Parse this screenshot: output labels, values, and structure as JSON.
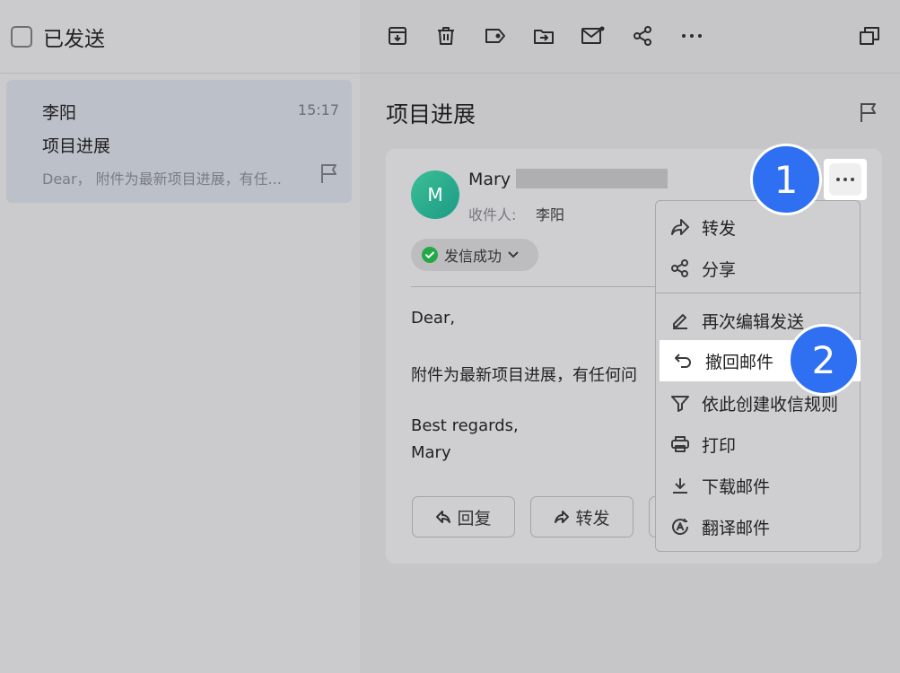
{
  "list": {
    "folder_title": "已发送",
    "item": {
      "sender": "李阳",
      "time": "15:17",
      "subject": "项目进展",
      "preview": "Dear， 附件为最新项目进展，有任..."
    }
  },
  "reader": {
    "subject": "项目进展",
    "sender_name": "Mary",
    "avatar_letter": "M",
    "recipient_label": "收件人:",
    "recipient_name": "李阳",
    "status": "发信成功",
    "body": {
      "greeting": "Dear,",
      "line1": "附件为最新项目进展，有任何问",
      "closing": "Best regards,",
      "signature": "Mary"
    },
    "actions": {
      "reply": "回复",
      "forward": "转发"
    }
  },
  "menu": {
    "items": [
      {
        "label": "转发",
        "icon": "forward-icon"
      },
      {
        "label": "分享",
        "icon": "share-icon"
      },
      {
        "label": "再次编辑发送",
        "icon": "edit-icon"
      },
      {
        "label": "撤回邮件",
        "icon": "undo-icon"
      },
      {
        "label": "依此创建收信规则",
        "icon": "filter-icon"
      },
      {
        "label": "打印",
        "icon": "print-icon"
      },
      {
        "label": "下载邮件",
        "icon": "download-icon"
      },
      {
        "label": "翻译邮件",
        "icon": "translate-icon"
      }
    ]
  },
  "annotations": {
    "step1": "1",
    "step2": "2"
  },
  "colors": {
    "accent_badge": "#2f6ff2",
    "status_ok": "#23a848",
    "avatar": "#24a98a"
  }
}
